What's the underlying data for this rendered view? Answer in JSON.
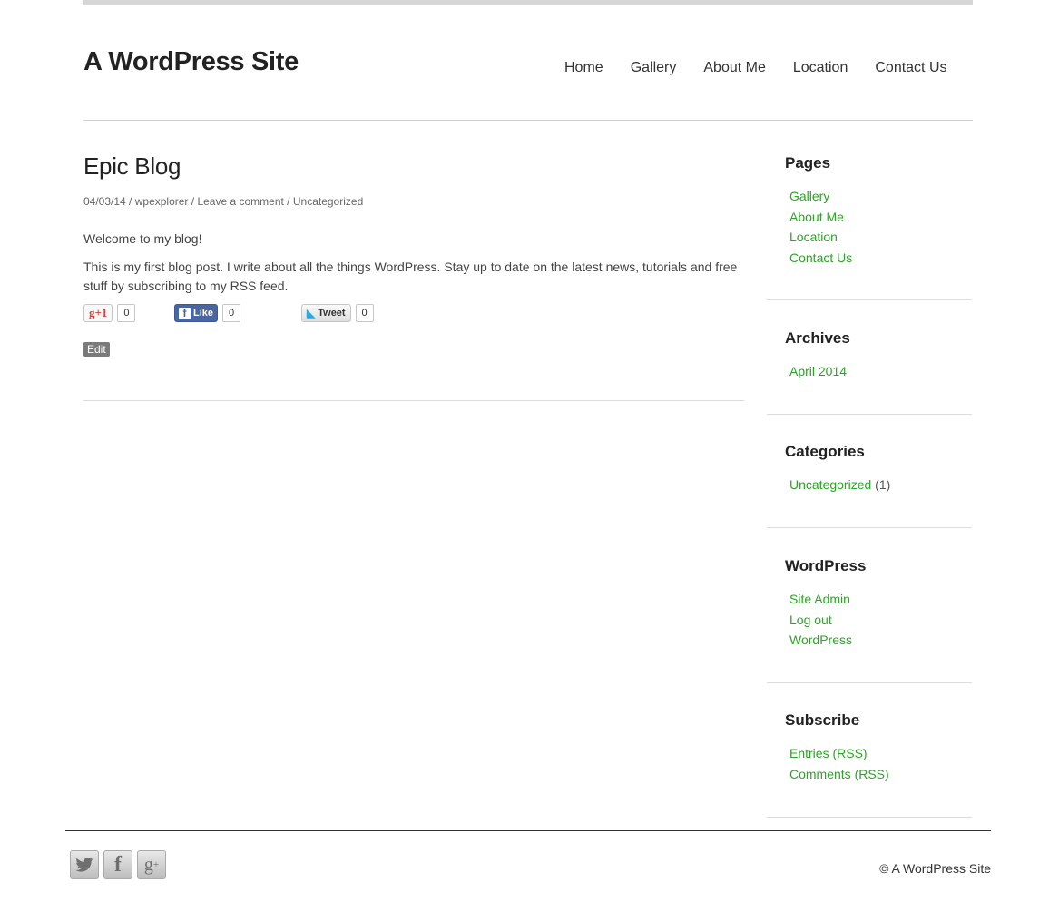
{
  "site": {
    "title": "A WordPress Site"
  },
  "nav": {
    "items": [
      "Home",
      "Gallery",
      "About Me",
      "Location",
      "Contact Us"
    ]
  },
  "post": {
    "title": "Epic Blog",
    "date": "04/03/14",
    "author": "wpexplorer",
    "comment_link": "Leave a comment",
    "category": "Uncategorized",
    "sep": " / ",
    "paragraphs": [
      "Welcome to my blog!",
      "This is my first blog post. I write about all the things WordPress. Stay up to date on the latest news, tutorials and free stuff by subscribing to my RSS feed."
    ],
    "share": {
      "gplus_label": "+1",
      "gplus_count": "0",
      "fb_label": "Like",
      "fb_count": "0",
      "tweet_label": "Tweet",
      "tweet_count": "0"
    },
    "edit_label": "Edit"
  },
  "sidebar": {
    "pages": {
      "title": "Pages",
      "items": [
        "Gallery",
        "About Me",
        "Location",
        "Contact Us"
      ]
    },
    "archives": {
      "title": "Archives",
      "items": [
        "April 2014"
      ]
    },
    "categories": {
      "title": "Categories",
      "items": [
        {
          "label": "Uncategorized",
          "count": "(1)"
        }
      ]
    },
    "wordpress": {
      "title": "WordPress",
      "items": [
        "Site Admin",
        "Log out",
        "WordPress"
      ]
    },
    "subscribe": {
      "title": "Subscribe",
      "items": [
        "Entries (RSS)",
        "Comments (RSS)"
      ]
    }
  },
  "footer": {
    "social_icons": [
      "twitter-icon",
      "facebook-icon",
      "google-plus-icon"
    ],
    "copyright": "© A WordPress Site"
  },
  "colors": {
    "link_green": "#29a623",
    "facebook_blue": "#4a66a0",
    "twitter_blue": "#2aa9e0",
    "gplus_red": "#d73d32"
  }
}
